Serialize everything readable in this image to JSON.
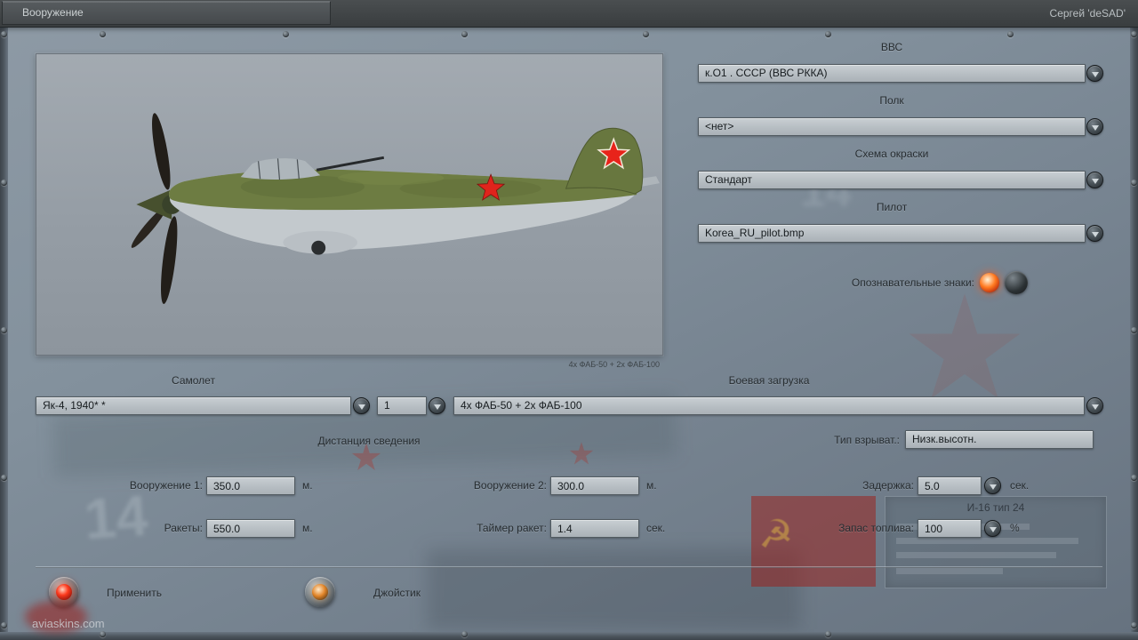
{
  "titlebar": {
    "tab_label": "Вооружение",
    "player_name": "Сергей 'deSAD'"
  },
  "preview": {
    "caption": "4х ФАБ-50 + 2х ФАБ-100"
  },
  "service": {
    "label": "ВВС",
    "value": "к.О1 . СССР (ВВС РККА)"
  },
  "regiment": {
    "label": "Полк",
    "value": "<нет>"
  },
  "paint_scheme": {
    "label": "Схема окраски",
    "value": "Стандарт"
  },
  "pilot": {
    "label": "Пилот",
    "value": "Korea_RU_pilot.bmp"
  },
  "markings": {
    "label": "Опознавательные знаки:"
  },
  "aircraft": {
    "label": "Самолет",
    "value": "Як-4, 1940* *",
    "count": "1"
  },
  "loadout": {
    "label": "Боевая загрузка",
    "value": "4х ФАБ-50 + 2х ФАБ-100"
  },
  "convergence": {
    "label": "Дистанция сведения"
  },
  "weapon1": {
    "label": "Вооружение 1:",
    "value": "350.0",
    "unit": "м."
  },
  "weapon2": {
    "label": "Вооружение 2:",
    "value": "300.0",
    "unit": "м."
  },
  "rockets": {
    "label": "Ракеты:",
    "value": "550.0",
    "unit": "м."
  },
  "rocket_timer": {
    "label": "Таймер ракет:",
    "value": "1.4",
    "unit": "сек."
  },
  "fuze_type": {
    "label": "Тип взрыват.:",
    "value": "Низк.высотн."
  },
  "delay": {
    "label": "Задержка:",
    "value": "5.0",
    "unit": "сек."
  },
  "fuel": {
    "label": "Запас топлива:",
    "value": "100",
    "unit": "%"
  },
  "footer": {
    "apply_label": "Применить",
    "joystick_label": "Джойстик"
  },
  "watermark": {
    "text": "aviaskins.com"
  },
  "background": {
    "plate_title": "И-16 тип 24",
    "stencil_number": "14",
    "flag_glyph": "☭"
  },
  "colors": {
    "accent_red": "#e0241c",
    "camo_green": "#6d7c42",
    "underside_gray": "#c3c9cd",
    "field_gray": "#b7bec3"
  }
}
